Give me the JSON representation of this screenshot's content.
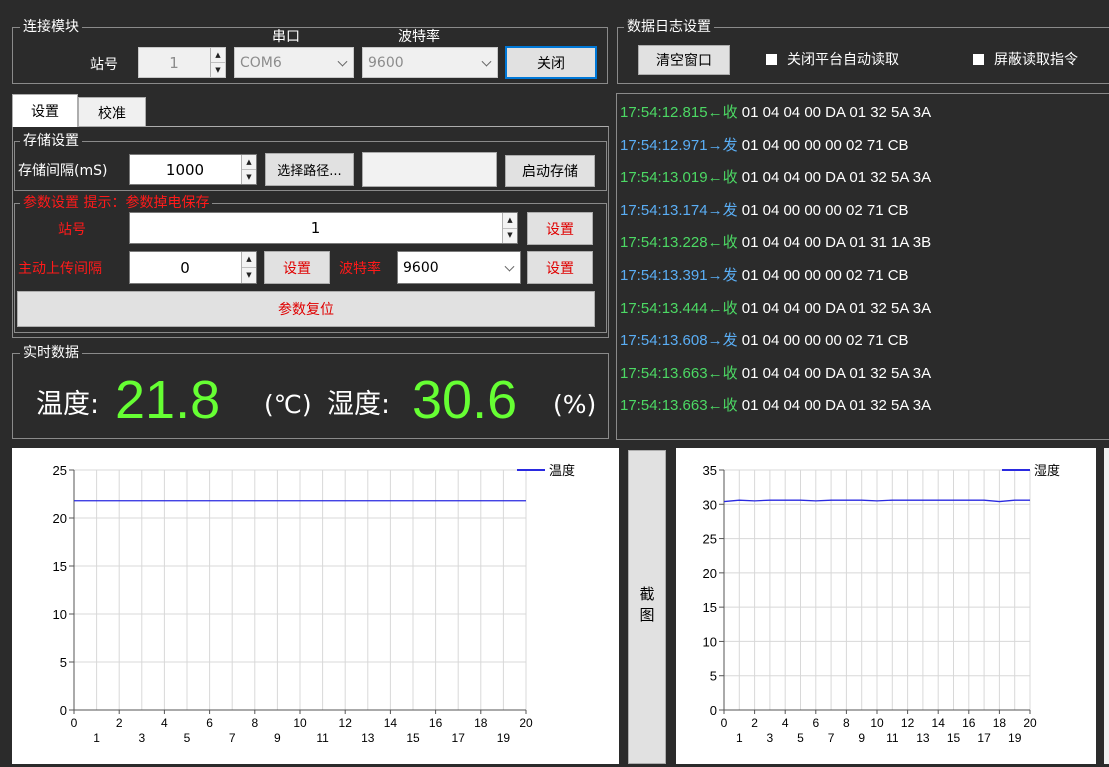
{
  "connection": {
    "title": "连接模块",
    "station_label": "站号",
    "station_value": "1",
    "port_label": "串口",
    "port_value": "COM6",
    "baud_label": "波特率",
    "baud_value": "9600",
    "close_button": "关闭"
  },
  "log_settings": {
    "title": "数据日志设置",
    "clear_button": "清空窗口",
    "disable_auto_read": "关闭平台自动读取",
    "mask_read_cmd": "屏蔽读取指令"
  },
  "tabs": [
    {
      "label": "设置",
      "active": true
    },
    {
      "label": "校准",
      "active": false
    }
  ],
  "storage": {
    "title": "存储设置",
    "interval_label": "存储间隔(mS)",
    "interval_value": "1000",
    "choose_path_button": "选择路径...",
    "path_value": "",
    "start_button": "启动存储"
  },
  "params": {
    "title": "参数设置 提示：参数掉电保存",
    "station_label": "站号",
    "station_value": "1",
    "set_label": "设置",
    "upload_label": "主动上传间隔",
    "upload_value": "0",
    "baud_label": "波特率",
    "baud_value": "9600",
    "reset_button": "参数复位"
  },
  "realtime": {
    "title": "实时数据",
    "temp_label": "温度:",
    "temp_value": "21.8",
    "temp_unit": "(℃)",
    "hum_label": "湿度:",
    "hum_value": "30.6",
    "hum_unit": "(%)"
  },
  "log": [
    {
      "time": "17:54:12.815",
      "dir": "←收",
      "type": "recv",
      "hex": " 01 04 04 00 DA 01 32 5A 3A"
    },
    {
      "time": "17:54:12.971",
      "dir": "→发",
      "type": "send",
      "hex": " 01 04 00 00 00 02 71 CB"
    },
    {
      "time": "17:54:13.019",
      "dir": "←收",
      "type": "recv",
      "hex": " 01 04 04 00 DA 01 32 5A 3A"
    },
    {
      "time": "17:54:13.174",
      "dir": "→发",
      "type": "send",
      "hex": " 01 04 00 00 00 02 71 CB"
    },
    {
      "time": "17:54:13.228",
      "dir": "←收",
      "type": "recv",
      "hex": " 01 04 04 00 DA 01 31 1A 3B"
    },
    {
      "time": "17:54:13.391",
      "dir": "→发",
      "type": "send",
      "hex": " 01 04 00 00 00 02 71 CB"
    },
    {
      "time": "17:54:13.444",
      "dir": "←收",
      "type": "recv",
      "hex": " 01 04 04 00 DA 01 32 5A 3A"
    },
    {
      "time": "17:54:13.608",
      "dir": "→发",
      "type": "send",
      "hex": " 01 04 00 00 00 02 71 CB"
    },
    {
      "time": "17:54:13.663",
      "dir": "←收",
      "type": "recv",
      "hex": " 01 04 04 00 DA 01 32 5A 3A"
    },
    {
      "time": "17:54:13.663",
      "dir": "←收",
      "type": "recv",
      "hex": " 01 04 04 00 DA 01 32 5A 3A"
    }
  ],
  "screenshot_button": "截图",
  "colors": {
    "bg": "#2b2b2b",
    "recv": "#4cd964",
    "send": "#5aaef5",
    "big_number": "#66ff33",
    "warning": "#ff1a1a",
    "series": "#2a2ae0"
  },
  "chart_data": [
    {
      "type": "line",
      "title": "",
      "xlabel": "",
      "ylabel": "",
      "xlim": [
        0,
        20
      ],
      "ylim": [
        0,
        25
      ],
      "yticks": [
        0,
        5,
        10,
        15,
        20,
        25
      ],
      "xticks_top": [
        0,
        2,
        4,
        6,
        8,
        10,
        12,
        14,
        16,
        18,
        20
      ],
      "xticks_bottom": [
        1,
        3,
        5,
        7,
        9,
        11,
        13,
        15,
        17,
        19
      ],
      "grid": true,
      "legend_position": "top-right",
      "series": [
        {
          "name": "温度",
          "x": [
            0,
            2,
            4,
            6,
            8,
            10,
            12,
            14,
            16,
            18,
            20
          ],
          "y": [
            21.8,
            21.8,
            21.8,
            21.8,
            21.8,
            21.8,
            21.8,
            21.8,
            21.8,
            21.8,
            21.8
          ]
        }
      ]
    },
    {
      "type": "line",
      "title": "",
      "xlabel": "",
      "ylabel": "",
      "xlim": [
        0,
        20
      ],
      "ylim": [
        0,
        35
      ],
      "yticks": [
        0,
        5,
        10,
        15,
        20,
        25,
        30,
        35
      ],
      "xticks_top": [
        0,
        2,
        4,
        6,
        8,
        10,
        12,
        14,
        16,
        18,
        20
      ],
      "xticks_bottom": [
        1,
        3,
        5,
        7,
        9,
        11,
        13,
        15,
        17,
        19
      ],
      "grid": true,
      "legend_position": "top-right",
      "series": [
        {
          "name": "湿度",
          "x": [
            0,
            1,
            2,
            3,
            4,
            5,
            6,
            7,
            8,
            9,
            10,
            11,
            12,
            13,
            14,
            15,
            16,
            17,
            18,
            19,
            20
          ],
          "y": [
            30.4,
            30.6,
            30.5,
            30.6,
            30.6,
            30.6,
            30.5,
            30.6,
            30.6,
            30.6,
            30.5,
            30.6,
            30.6,
            30.6,
            30.6,
            30.6,
            30.6,
            30.6,
            30.4,
            30.6,
            30.6
          ]
        }
      ]
    }
  ]
}
